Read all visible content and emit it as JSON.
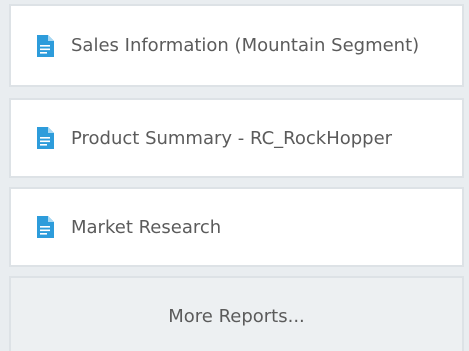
{
  "reports": {
    "items": [
      {
        "label": "Sales Information (Mountain Segment)",
        "icon": "document-icon"
      },
      {
        "label": "Product Summary - RC_RockHopper",
        "icon": "document-icon"
      },
      {
        "label": "Market Research",
        "icon": "document-icon"
      }
    ],
    "more_label": "More Reports..."
  },
  "colors": {
    "icon_blue": "#2d9cdb",
    "text": "#5b5b5b",
    "card_border": "#dde2e6",
    "page_background": "#e9edf0"
  }
}
